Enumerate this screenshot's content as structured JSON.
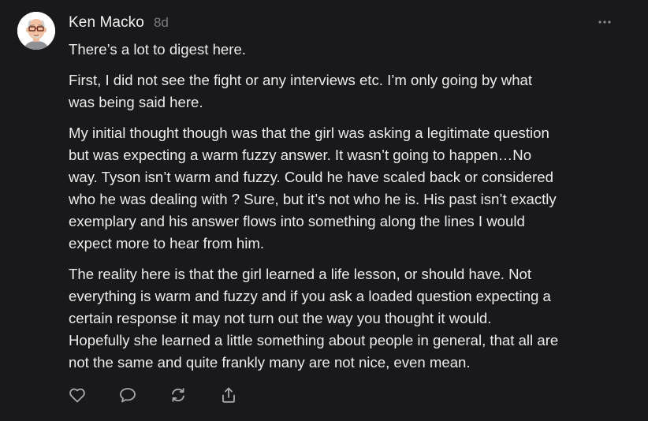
{
  "comment": {
    "author": "Ken Macko",
    "age": "8d",
    "paragraphs": [
      {
        "lines": [
          "There’s a lot to digest here."
        ]
      },
      {
        "lines": [
          "First, I did not see the fight or any interviews etc. I’m only going by what",
          "was being said here."
        ]
      },
      {
        "lines": [
          "My initial thought though was that the girl was asking a legitimate question",
          "but was expecting a warm fuzzy answer. It wasn’t going to happen…No",
          "way. Tyson isn’t warm and fuzzy. Could he have scaled back or considered",
          "who he was dealing with ? Sure, but it’s not who he is. His past isn’t exactly",
          "exemplary and his answer flows into something along the lines I would",
          "expect more to hear from him."
        ]
      },
      {
        "lines": [
          "The reality here is that the girl learned a life lesson, or should have. Not",
          "everything is warm and fuzzy and if you ask a loaded question expecting a",
          "certain response it may not turn out the way you thought it would.",
          "Hopefully she learned a little something about people in general, that all are",
          "not the same and quite frankly many are not nice, even mean."
        ]
      }
    ]
  },
  "icons": {
    "avatar": "bitmoji-avatar",
    "more": "more-horizontal-icon",
    "like": "heart-icon",
    "reply": "comment-bubble-icon",
    "restack": "restack-icon",
    "share": "share-icon"
  },
  "colors": {
    "background": "#19191b",
    "text": "#ececec",
    "muted": "#7c7c80",
    "icon": "#a9a9ad"
  }
}
